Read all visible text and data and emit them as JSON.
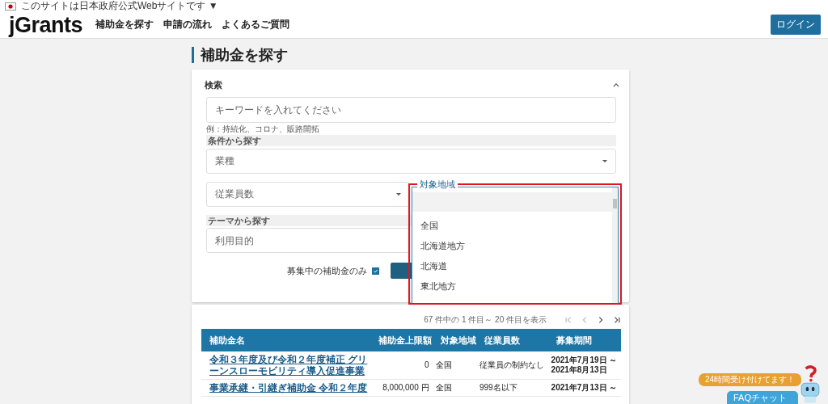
{
  "gov_banner": {
    "text": "このサイトは日本政府公式Webサイトです ▼"
  },
  "header": {
    "logo": "jGrants",
    "nav": [
      {
        "label": "補助金を探す"
      },
      {
        "label": "申請の流れ"
      },
      {
        "label": "よくあるご質問"
      }
    ],
    "login": "ログイン"
  },
  "page_title": "補助金を探す",
  "search_panel": {
    "title": "検索",
    "expanded": true,
    "keyword": {
      "placeholder": "キーワードを入れてください",
      "hint": "例：持続化、コロナ、販路開拓"
    },
    "condition_heading": "条件から探す",
    "industry": {
      "placeholder": "業種"
    },
    "employees": {
      "placeholder": "従業員数"
    },
    "region": {
      "label": "対象地域",
      "expanded": true,
      "options": [
        {
          "label": "全国",
          "selected": false
        },
        {
          "label": "北海道地方",
          "selected": false
        },
        {
          "label": "北海道",
          "selected": false
        },
        {
          "label": "東北地方",
          "selected": false
        }
      ]
    },
    "theme_heading": "テーマから探す",
    "purpose": {
      "placeholder": "利用目的"
    },
    "open_only": {
      "label": "募集中の補助金のみ",
      "checked": true
    }
  },
  "results": {
    "summary": "67 件中の 1 件目～ 20 件目を表示",
    "pagination": [
      {
        "kind": "first",
        "disabled": true
      },
      {
        "kind": "prev",
        "disabled": true
      },
      {
        "kind": "next",
        "disabled": false
      },
      {
        "kind": "last",
        "disabled": false
      }
    ],
    "columns": [
      "補助金名",
      "補助金上限額",
      "対象地域",
      "従業員数",
      "募集期間"
    ],
    "rows": [
      {
        "name": "令和３年度及び令和２年度補正 グリーンスローモビリティ導入促進事業",
        "amount": "0",
        "region": "全国",
        "employees": "従業員の制約なし",
        "period": [
          "2021年7月19日 ～",
          "2021年8月13日"
        ]
      },
      {
        "name": "事業承継・引継ぎ補助金 令和２年度",
        "amount": "8,000,000 円",
        "region": "全国",
        "employees": "999名以下",
        "period": [
          "2021年7月13日 ～"
        ]
      }
    ]
  },
  "faq": {
    "bubble": "24時間受け付けてます！",
    "button": "FAQチャット"
  }
}
